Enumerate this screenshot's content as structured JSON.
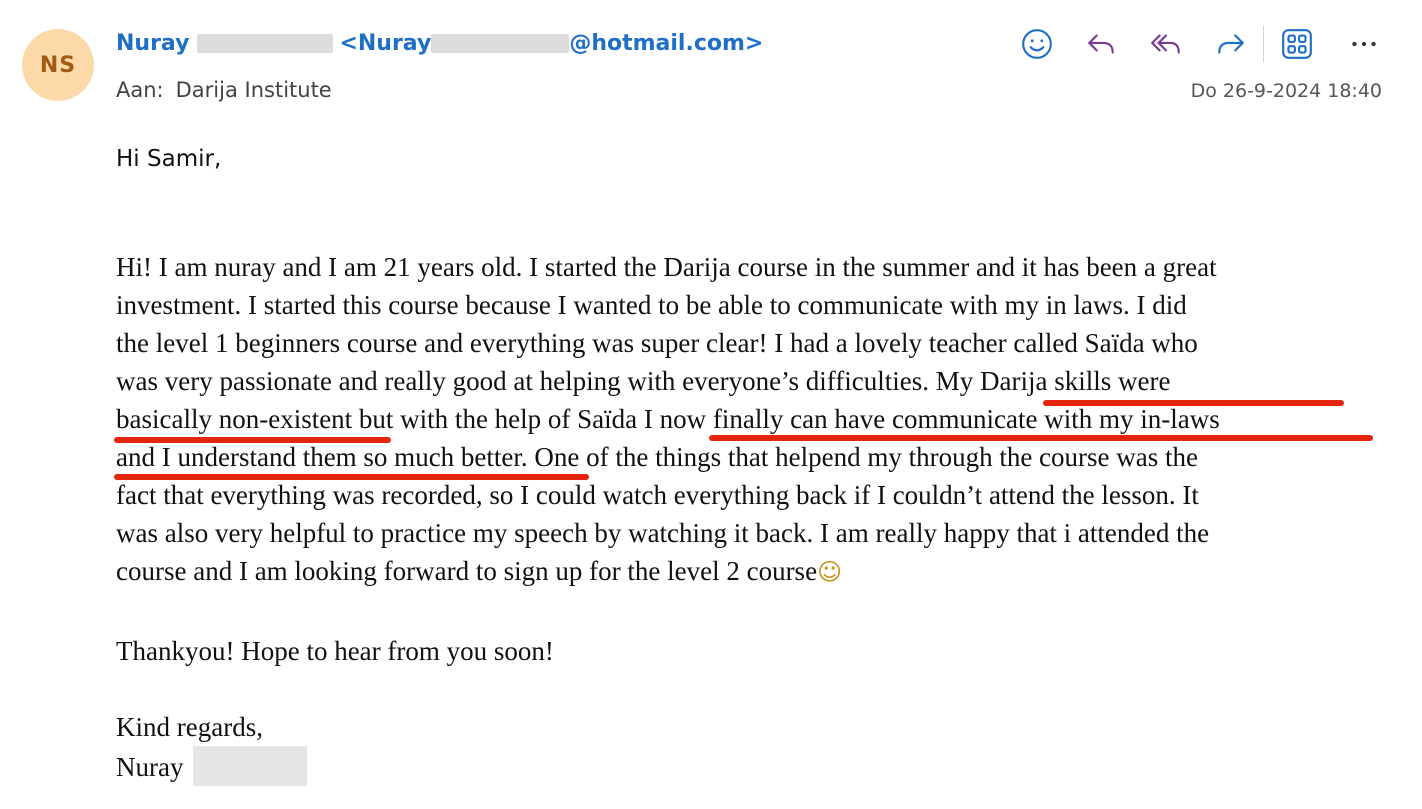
{
  "sender": {
    "initials": "NS",
    "first_name": "Nuray",
    "email_prefix": "<Nuray",
    "email_suffix": "@hotmail.com>"
  },
  "recipient": {
    "label": "Aan:",
    "name": "Darija Institute"
  },
  "date": "Do 26-9-2024 18:40",
  "toolbar_icons": [
    "emoji-icon",
    "reply-icon",
    "reply-all-icon",
    "forward-icon",
    "apps-icon",
    "more-icon"
  ],
  "colors": {
    "accent": "#1f6fc5",
    "reply_purple": "#7a3b96",
    "highlight_red": "#e4260e",
    "avatar_bg": "#fbd9a8"
  },
  "body": {
    "greeting": "Hi Samir,",
    "lines": [
      "Hi! I am nuray and I am 21 years old. I started the Darija course in the summer and it has been a great",
      "investment. I started this course because I wanted to be able to communicate with my in laws. I did",
      "the level 1 beginners course and everything was super clear! I had a lovely teacher called Saïda who",
      "was very passionate and really good at helping with everyone’s difficulties. My Darija skills were",
      "basically non-existent but with the help of Saïda I now finally can have communicate with my in-laws",
      "and I understand them so much better. One of the things that helpend my through the course was the",
      "fact that everything was recorded, so I could watch everything back if I couldn’t attend the lesson. It",
      "was also very helpful to practice my speech by watching it back. I am really happy that i attended the",
      "course and I am looking forward to sign up for the level 2 course"
    ],
    "emoji": "☺",
    "thanks": "Thankyou! Hope to hear from you soon!",
    "closing": "Kind regards,",
    "signature": "Nuray"
  }
}
